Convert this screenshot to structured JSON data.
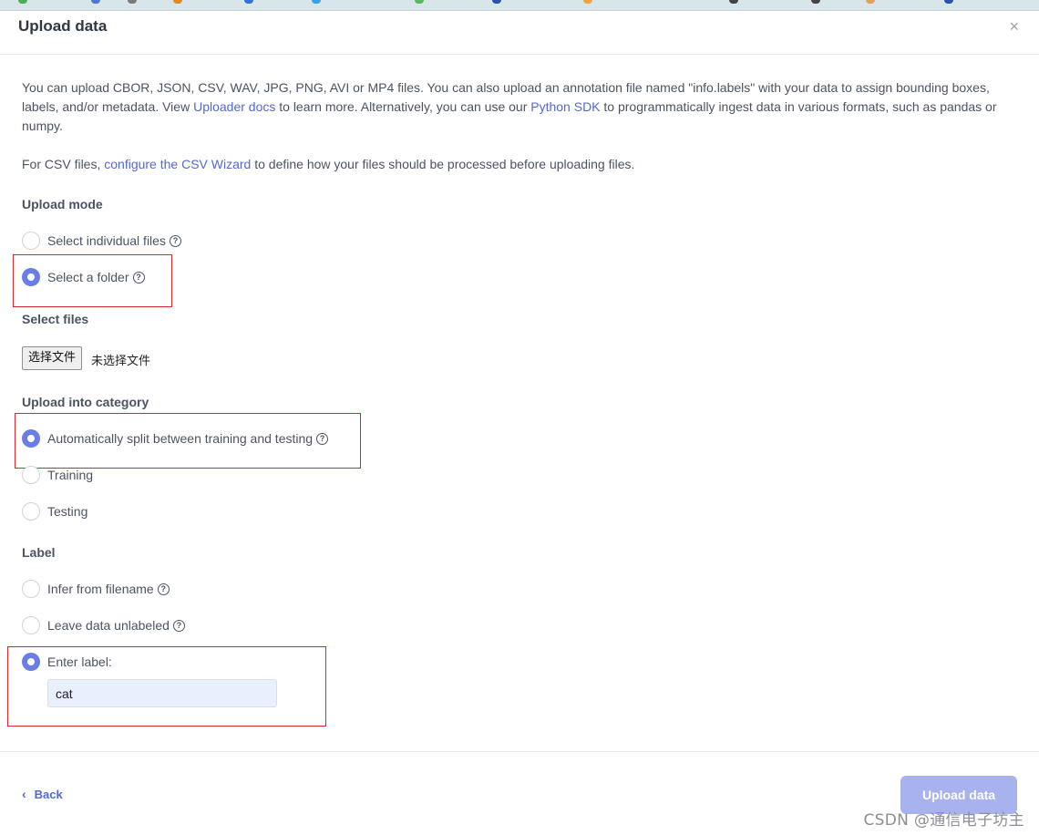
{
  "dialog": {
    "title": "Upload data",
    "close_label": "×"
  },
  "intro": {
    "part1": "You can upload CBOR, JSON, CSV, WAV, JPG, PNG, AVI or MP4 files. You can also upload an annotation file named \"info.labels\" with your data to assign bounding boxes, labels, and/or metadata. View ",
    "link1": "Uploader docs",
    "part2": " to learn more. Alternatively, you can use our ",
    "link2": "Python SDK",
    "part3": " to programmatically ingest data in various formats, such as pandas or numpy."
  },
  "csv_note": {
    "part1": "For CSV files, ",
    "link": "configure the CSV Wizard",
    "part2": " to define how your files should be processed before uploading files."
  },
  "upload_mode": {
    "heading": "Upload mode",
    "options": [
      {
        "label": "Select individual files",
        "checked": false,
        "help": "?"
      },
      {
        "label": "Select a folder",
        "checked": true,
        "help": "?"
      }
    ]
  },
  "select_files": {
    "heading": "Select files",
    "button_label": "选择文件",
    "status": "未选择文件"
  },
  "category": {
    "heading": "Upload into category",
    "options": [
      {
        "label": "Automatically split between training and testing",
        "checked": true,
        "help": "?"
      },
      {
        "label": "Training",
        "checked": false
      },
      {
        "label": "Testing",
        "checked": false
      }
    ]
  },
  "label": {
    "heading": "Label",
    "options": [
      {
        "label": "Infer from filename",
        "checked": false,
        "help": "?"
      },
      {
        "label": "Leave data unlabeled",
        "checked": false,
        "help": "?"
      },
      {
        "label": "Enter label:",
        "checked": true
      }
    ],
    "input_value": "cat"
  },
  "footer": {
    "back_chevron": "‹",
    "back_label": "Back",
    "upload_label": "Upload data"
  },
  "watermark": "CSDN @通信电子坊主",
  "colors": {
    "accent": "#6a7ee6",
    "link": "#5468d4",
    "highlight_box": "#d9272e",
    "upload_button": "#a8b2ee"
  }
}
